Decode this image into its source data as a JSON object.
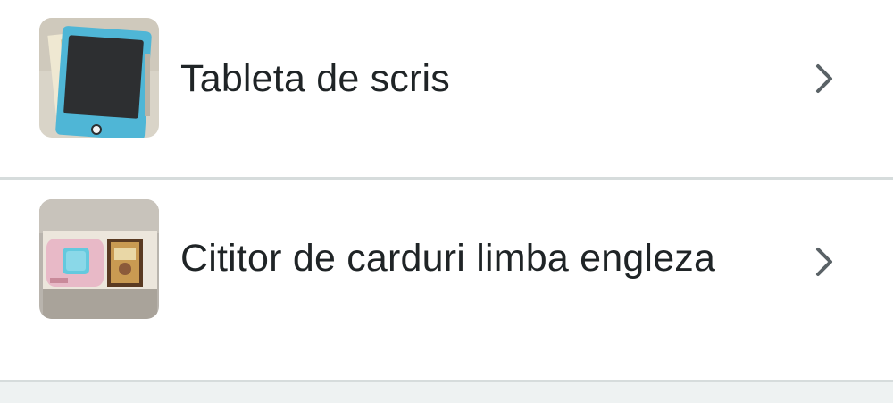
{
  "list": {
    "items": [
      {
        "label": "Tableta de scris",
        "thumbnail": "writing-tablet-photo",
        "chevron": "chevron-right-icon"
      },
      {
        "label": "Cititor de carduri limba engleza",
        "thumbnail": "card-reader-photo",
        "chevron": "chevron-right-icon"
      }
    ]
  },
  "colors": {
    "text": "#1f2426",
    "chevron": "#5a6266",
    "divider": "#d6dcdc",
    "background": "#eef2f2"
  }
}
